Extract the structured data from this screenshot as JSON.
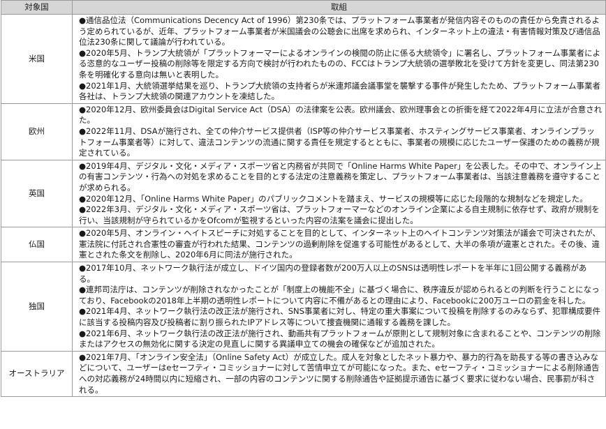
{
  "header": {
    "country": "対象国",
    "content": "取組"
  },
  "rows": [
    {
      "country": "米国",
      "items": [
        "●通信品位法（Communications Decency Act of 1996）第230条では、プラットフォーム事業者が発信内容そのものの責任から免責されるよう定められているが、近年、プラットフォーム事業者が米国議会の公聴会に出席を求められ、インターネット上の違法・有害情報対策及び通信品位法230条に関して議論が行われている。",
        "●2020年5月、トランプ大統領が「プラットフォーマーによるオンラインの検閲の防止に係る大統領令」に署名し、プラットフォーム事業者による恣意的なユーザー投稿の削除等を限定する方向で検討が行われたものの、FCCはトランプ大統領の選挙敗北を受けて方針を変更し、同法第230条を明確化する意向は無いと表明した。",
        "●2021年1月、大統領選挙結果を巡り、トランプ大統領の支持者らが米連邦議会議事堂を襲撃する事件が発生したため、プラットフォーム事業者各社は、トランプ大統領の関連アカウントを凍結した。"
      ]
    },
    {
      "country": "欧州",
      "items": [
        "●2020年12月、欧州委員会はDigital Service Act（DSA）の法律案を公表。欧州議会、欧州理事会との折衝を経て2022年4月に立法が合意された。",
        "●2022年11月、DSAが施行され、全ての仲介サービス提供者（ISP等の仲介サービス事業者、ホスティングサービス事業者、オンラインプラットフォーム事業者等）に対して、違法コンテンツの流通に関する責任を規定するとともに、事業者の規模に応じたユーザー保護のための義務が規定されている。"
      ]
    },
    {
      "country": "英国",
      "items": [
        "●2019年4月、デジタル・文化・メディア・スポーツ省と内務省が共同で「Online Harms White Paper」を公表した。その中で、オンライン上の有害コンテンツ・行為への対処を求めることを目的とする法定の注意義務を策定し、プラットフォーム事業者は、当該注意義務を遵守することが求められる。",
        "●2020年12月、「Online Harms White Paper」のパブリックコメントを踏まえ、サービスの規模等に応じた段階的な規制などを規定した。",
        "●2022年3月、デジタル・文化・メディア・スポーツ省は、プラットフォーマーなどのオンライン企業による自主規制に依存せず、政府が規制を行い、当該規制が守られているかをOfcomが監視するといった内容の法案を議会に提出した。"
      ]
    },
    {
      "country": "仏国",
      "items": [
        "●2020年5月、オンライン・ヘイトスピーチに対処することを目的として、インターネット上のヘイトコンテンツ対策法が議会で可決されたが、憲法院に付託され合憲性の審査が行われた結果、コンテンツの過剰削除を促進する可能性があるとして、大半の条項が違憲とされた。その後、違憲とされた条文を削除し、2020年6月に同法が施行された。"
      ]
    },
    {
      "country": "独国",
      "items": [
        "●2017年10月、ネットワーク執行法が成立し、ドイツ国内の登録者数が200万人以上のSNSは透明性レポートを半年に1回公開する義務がある。",
        "●連邦司法庁は、コンテンツが削除されなかったことが「制度上の機能不全」に基づく場合に、秩序違反が認められるとの判断を行うことになっており、Facebookの2018年上半期の透明性レポートについて内容に不備があるとの理由により、Facebookに200万ユーロの罰金を科した。",
        "●2021年4月、ネットワーク執行法の改正法が施行され、SNS事業者に対し、特定の重大事案について投稿を削除するのみならず、犯罪構成要件に該当する投稿内容及び投稿者に割り振られたIPアドレス等について捜査機関に通報する義務を課した。",
        "●2021年6月、ネットワーク執行法の改正法が施行され、動画共有プラットフォームが原則として規制対象に含まれることや、コンテンツの削除またはアクセスの無効化に関する決定の見直しに関する異議申立ての機会の確保などが追加された。"
      ]
    },
    {
      "country": "オーストラリア",
      "items": [
        "●2021年7月、「オンライン安全法」（Online Safety Act）が成立した。成人を対象としたネット暴力や、暴力的行為を助長する等の書き込みなどについて、ユーザーはeセーフティ・コミッショナーに対して苦情申立てが可能になった。また、eセーフティ・コミッショナーによる削除通告への対応義務が24時間以内に短縮され、一部の内容のコンテンツに関する削除通告や証拠提示通告に基づく要求に従わない場合、民事罰が科される。"
      ]
    }
  ]
}
